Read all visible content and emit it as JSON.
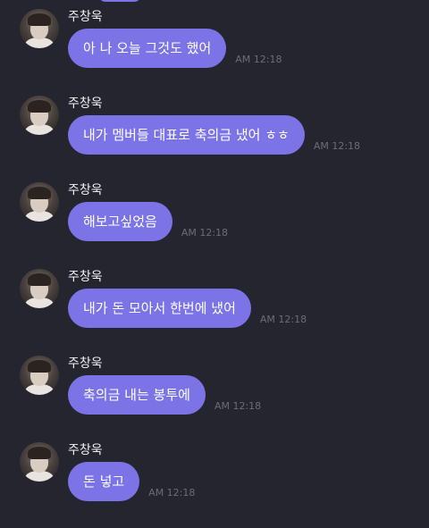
{
  "colors": {
    "background": "#25252f",
    "bubble": "#7c74e6",
    "bubble_text": "#ffffff",
    "sender_text": "#f2f2f5",
    "time_text": "#6c6c78"
  },
  "messages": [
    {
      "sender": "주창욱",
      "text": "아 나 오늘 그것도 했어",
      "time": "AM 12:18",
      "avatar_icon": "profile-photo"
    },
    {
      "sender": "주창욱",
      "text": "내가 멤버들 대표로 축의금 냈어 ㅎㅎ",
      "time": "AM 12:18",
      "avatar_icon": "profile-photo"
    },
    {
      "sender": "주창욱",
      "text": "해보고싶었음",
      "time": "AM 12:18",
      "avatar_icon": "profile-photo"
    },
    {
      "sender": "주창욱",
      "text": "내가 돈 모아서 한번에 냈어",
      "time": "AM 12:18",
      "avatar_icon": "profile-photo"
    },
    {
      "sender": "주창욱",
      "text": "축의금 내는 봉투에",
      "time": "AM 12:18",
      "avatar_icon": "profile-photo"
    },
    {
      "sender": "주창욱",
      "text": "돈 넣고",
      "time": "AM 12:18",
      "avatar_icon": "profile-photo"
    }
  ]
}
